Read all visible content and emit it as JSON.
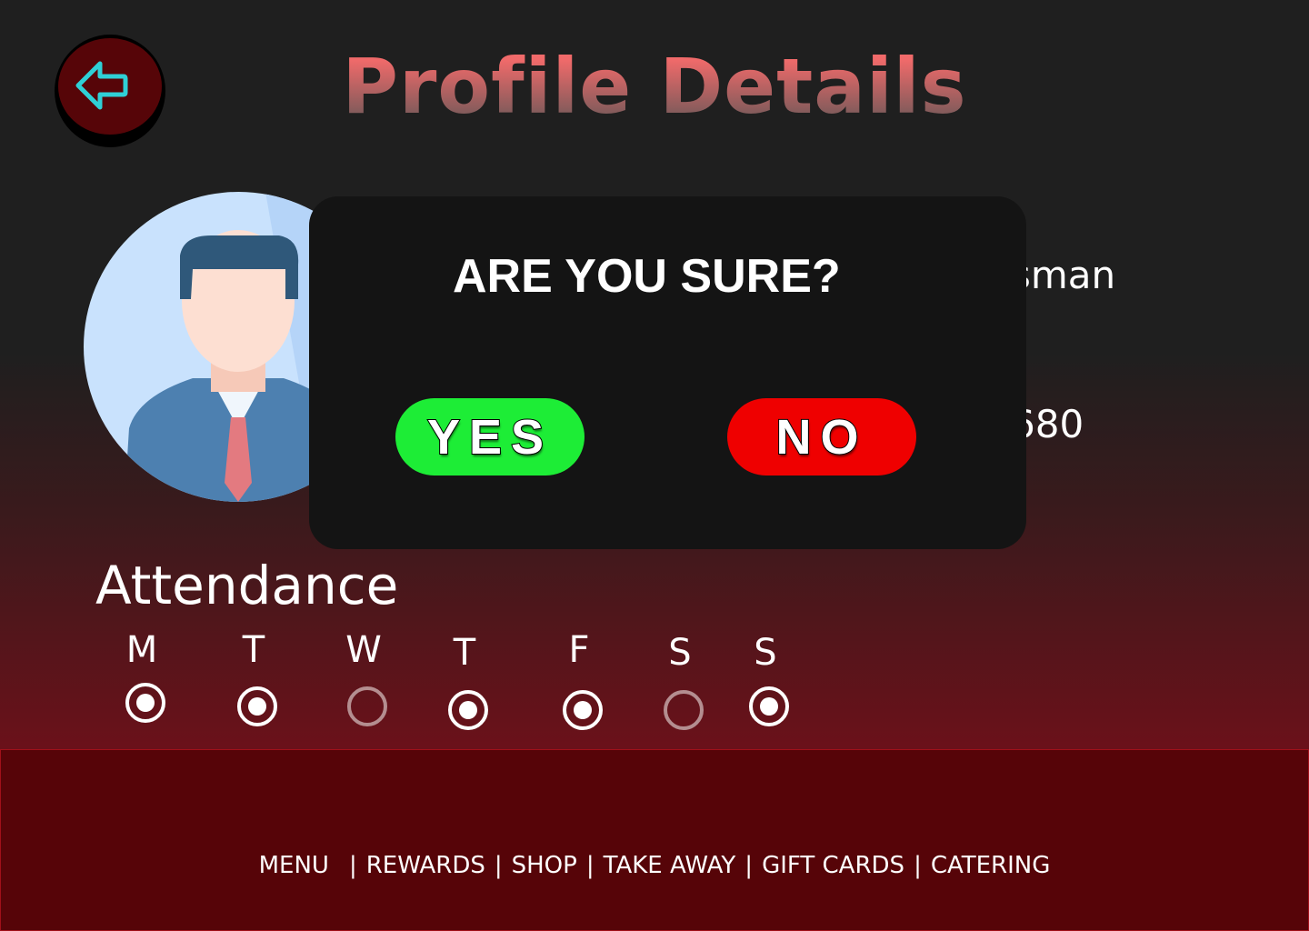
{
  "header": {
    "title": "Profile Details",
    "back_icon": "arrow-left-icon"
  },
  "profile": {
    "name_fragment": "sman",
    "phone_fragment": "680"
  },
  "dialog": {
    "question": "ARE YOU SURE?",
    "yes_label": "YES",
    "no_label": "NO"
  },
  "attendance": {
    "title": "Attendance",
    "days": [
      {
        "label": "M",
        "checked": true
      },
      {
        "label": "T",
        "checked": true
      },
      {
        "label": "W",
        "checked": false
      },
      {
        "label": "T",
        "checked": true
      },
      {
        "label": "F",
        "checked": true
      },
      {
        "label": "S",
        "checked": false
      },
      {
        "label": "S",
        "checked": true
      }
    ]
  },
  "footer": {
    "items": [
      "MENU",
      "REWARDS",
      "SHOP",
      "TAKE AWAY",
      "GIFT CARDS",
      "CATERING"
    ],
    "separator": "|"
  }
}
